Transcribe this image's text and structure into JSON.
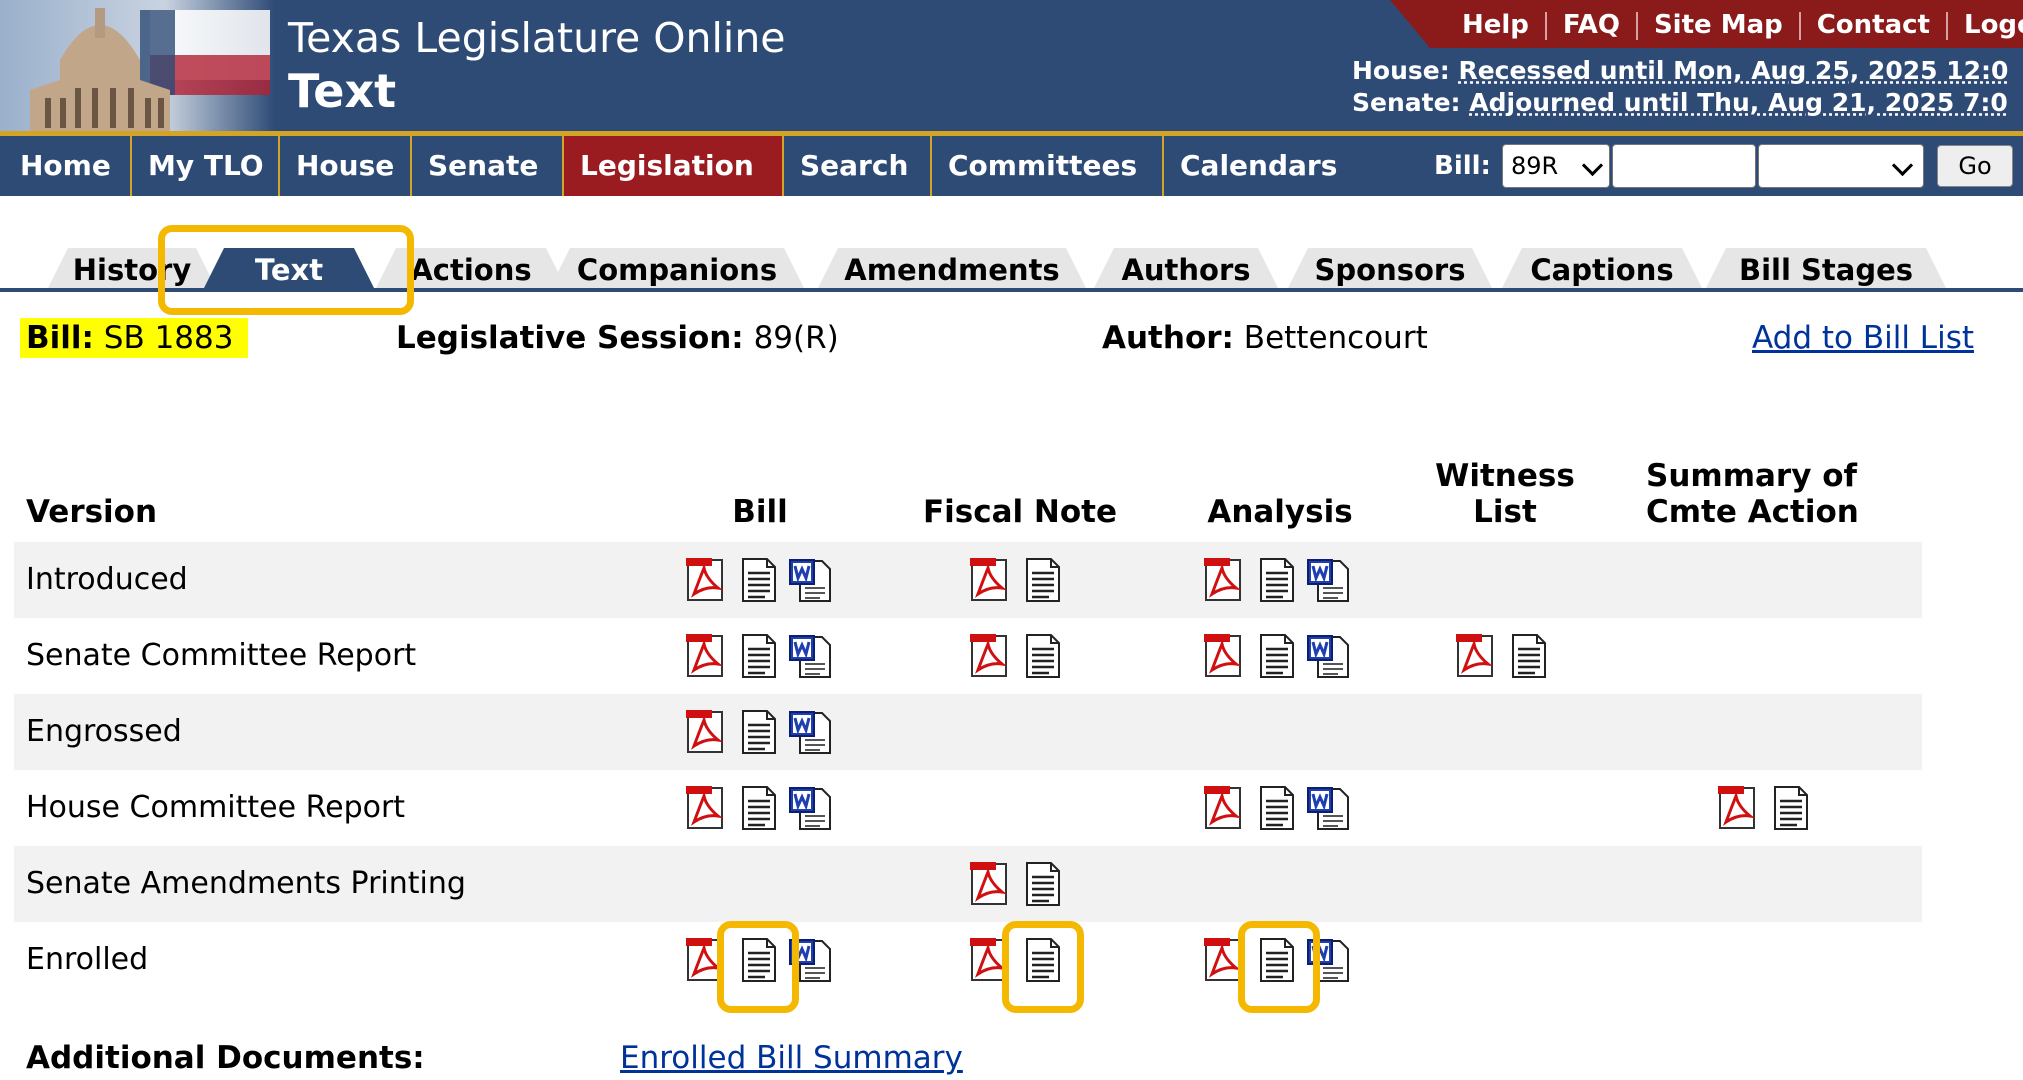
{
  "header": {
    "site_title": "Texas Legislature Online",
    "page_heading": "Text",
    "top_links": [
      "Help",
      "FAQ",
      "Site Map",
      "Contact",
      "Logo"
    ],
    "house_label": "House:",
    "house_status": "Recessed until Mon, Aug 25, 2025 12:0",
    "senate_label": "Senate:",
    "senate_status": "Adjourned until Thu, Aug 21, 2025 7:0"
  },
  "nav": {
    "items": [
      "Home",
      "My TLO",
      "House",
      "Senate",
      "Legislation",
      "Search",
      "Committees",
      "Calendars"
    ],
    "active": "Legislation",
    "bill_label": "Bill:",
    "session_select": "89R",
    "bill_number_input": "",
    "bill_type_select": "",
    "go_label": "Go"
  },
  "tabs": [
    "History",
    "Text",
    "Actions",
    "Companions",
    "Amendments",
    "Authors",
    "Sponsors",
    "Captions",
    "Bill Stages"
  ],
  "active_tab": "Text",
  "info": {
    "bill_label": "Bill:",
    "bill_value": "SB 1883",
    "session_label": "Legislative Session:",
    "session_value": "89(R)",
    "author_label": "Author:",
    "author_value": "Bettencourt",
    "add_link": "Add to Bill List"
  },
  "table": {
    "headers": {
      "version": "Version",
      "bill": "Bill",
      "fiscal": "Fiscal Note",
      "analysis": "Analysis",
      "witness_l1": "Witness",
      "witness_l2": "List",
      "summary_l1": "Summary of",
      "summary_l2": "Cmte Action"
    },
    "rows": [
      {
        "version": "Introduced",
        "bill": [
          "pdf",
          "txt",
          "doc"
        ],
        "fiscal": [
          "pdf",
          "txt"
        ],
        "analysis": [
          "pdf",
          "txt",
          "doc"
        ],
        "witness": [],
        "summary": []
      },
      {
        "version": "Senate Committee Report",
        "bill": [
          "pdf",
          "txt",
          "doc"
        ],
        "fiscal": [
          "pdf",
          "txt"
        ],
        "analysis": [
          "pdf",
          "txt",
          "doc"
        ],
        "witness": [
          "pdf",
          "txt"
        ],
        "summary": []
      },
      {
        "version": "Engrossed",
        "bill": [
          "pdf",
          "txt",
          "doc"
        ],
        "fiscal": [],
        "analysis": [],
        "witness": [],
        "summary": []
      },
      {
        "version": "House Committee Report",
        "bill": [
          "pdf",
          "txt",
          "doc"
        ],
        "fiscal": [],
        "analysis": [
          "pdf",
          "txt",
          "doc"
        ],
        "witness": [],
        "summary": [
          "pdf",
          "txt"
        ]
      },
      {
        "version": "Senate Amendments Printing",
        "bill": [],
        "fiscal": [
          "pdf",
          "txt"
        ],
        "analysis": [],
        "witness": [],
        "summary": []
      },
      {
        "version": "Enrolled",
        "bill": [
          "pdf",
          "txt",
          "doc"
        ],
        "fiscal": [
          "pdf",
          "txt"
        ],
        "analysis": [
          "pdf",
          "txt",
          "doc"
        ],
        "witness": [],
        "summary": []
      }
    ]
  },
  "additional": {
    "label": "Additional Documents:",
    "link": "Enrolled Bill Summary"
  },
  "colors": {
    "header_blue": "#2e4b76",
    "active_red": "#9b1c20",
    "gold": "#d3a526",
    "highlight": "#f5b800",
    "bill_badge": "#ffff00"
  }
}
